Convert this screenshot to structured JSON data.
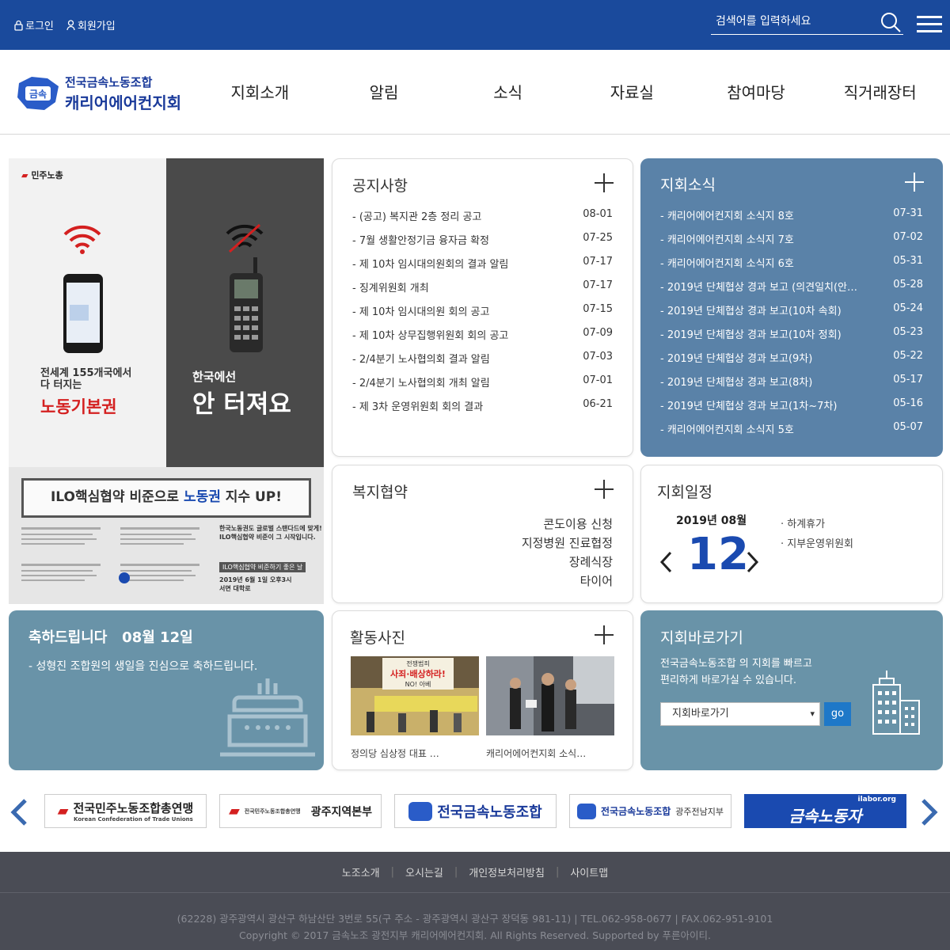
{
  "topbar": {
    "login": "로그인",
    "signup": "회원가입",
    "search_placeholder": "검색어를 입력하세요"
  },
  "logo": {
    "line1": "전국금속노동조합",
    "line2": "캐리어에어컨지회",
    "badge": "금속"
  },
  "nav": [
    "지회소개",
    "알림",
    "소식",
    "자료실",
    "참여마당",
    "직거래장터"
  ],
  "banner": {
    "brand": "민주노총",
    "left_line1": "전세계 155개국에서",
    "left_line2": "다 터지는",
    "left_line3": "노동기본권",
    "right_line1": "한국에선",
    "right_line2": "안 터져요",
    "box_prefix": "ILO핵심협약 비준으로",
    "box_highlight": "노동권",
    "box_suffix": "지수 UP!",
    "foot1": "한국노동권도 글로벌 스탠다드에 맞게!",
    "foot2": "ILO핵심협약 비준이 그 시작입니다.",
    "tag": "ILO핵심협약 비준하기 좋은 날",
    "date": "2019년 6월 1일 오후3시",
    "place": "서면 대학로"
  },
  "notice": {
    "title": "공지사항",
    "items": [
      {
        "title": "- (공고) 복지관 2층 정리 공고",
        "date": "08-01"
      },
      {
        "title": "- 7월 생활안정기금 융자금 확정",
        "date": "07-25"
      },
      {
        "title": "- 제 10차 임시대의원회의 결과 알림",
        "date": "07-17"
      },
      {
        "title": "- 징계위원회 개최",
        "date": "07-17"
      },
      {
        "title": "- 제 10차 임시대의원 회의 공고",
        "date": "07-15"
      },
      {
        "title": "- 제 10차 상무집행위원회 회의 공고",
        "date": "07-09"
      },
      {
        "title": "- 2/4분기 노사협의회 결과 알림",
        "date": "07-03"
      },
      {
        "title": "- 2/4분기 노사협의회 개최 알림",
        "date": "07-01"
      },
      {
        "title": "- 제 3차 운영위원회 회의 결과",
        "date": "06-21"
      }
    ]
  },
  "news": {
    "title": "지회소식",
    "items": [
      {
        "title": "- 캐리어에어컨지회 소식지 8호",
        "date": "07-31"
      },
      {
        "title": "- 캐리어에어컨지회 소식지 7호",
        "date": "07-02"
      },
      {
        "title": "- 캐리어에어컨지회 소식지 6호",
        "date": "05-31"
      },
      {
        "title": "- 2019년 단체협상 경과 보고 (의견일치(안…",
        "date": "05-28"
      },
      {
        "title": "- 2019년 단체협상 경과 보고(10차 속회)",
        "date": "05-24"
      },
      {
        "title": "- 2019년 단체협상 경과 보고(10차 정회)",
        "date": "05-23"
      },
      {
        "title": "- 2019년 단체협상 경과 보고(9차)",
        "date": "05-22"
      },
      {
        "title": "- 2019년 단체협상 경과 보고(8차)",
        "date": "05-17"
      },
      {
        "title": "- 2019년 단체협상 경과 보고(1차~7차)",
        "date": "05-16"
      },
      {
        "title": "- 캐리어에어컨지회 소식지 5호",
        "date": "05-07"
      }
    ]
  },
  "welfare": {
    "title": "복지협약",
    "items": [
      "콘도이용 신청",
      "지정병원 진료협정",
      "장례식장",
      "타이어"
    ]
  },
  "schedule": {
    "title": "지회일정",
    "month": "2019년 08월",
    "day": "12",
    "events": [
      "· 하계휴가",
      "· 지부운영위원회"
    ]
  },
  "birthday": {
    "title": "축하드립니다",
    "date": "08월 12일",
    "message": "- 성형진 조합원의 생일을 진심으로 축하드립니다."
  },
  "photos": {
    "title": "활동사진",
    "items": [
      {
        "caption": "정의당 심상정 대표 …",
        "sign1": "전쟁범죄",
        "sign2": "사죄·배상하라!",
        "sign3": "NO! 아베"
      },
      {
        "caption": "캐리어에어컨지회 소식…"
      }
    ]
  },
  "quicklink": {
    "title": "지회바로가기",
    "desc1": "전국금속노동조합 의 지회를 빠르고",
    "desc2": "편리하게 바로가실 수 있습니다.",
    "select": "지회바로가기",
    "go": "go"
  },
  "partners": [
    {
      "name": "전국민주노동조합총연맹",
      "sub": "Korean Confederation of Trade Unions"
    },
    {
      "name": "광주지역본부",
      "sub": "전국민주노동조합총연맹"
    },
    {
      "name": "전국금속노동조합"
    },
    {
      "name": "전국금속노동조합",
      "sub": "광주전남지부"
    },
    {
      "name": "금속노동자",
      "sub": "ilabor.org"
    }
  ],
  "footer": {
    "links": [
      "노조소개",
      "오시는길",
      "개인정보처리방침",
      "사이트맵"
    ],
    "address": "(62228) 광주광역시 광산구 하남산단 3번로 55(구 주소 - 광주광역시 광산구 장덕동 981-11)  |  TEL.062-958-0677  |  FAX.062-951-9101",
    "copyright": "Copyright © 2017 금속노조 광전지부 캐리어에어컨지회. All Rights Reserved. Supported by 푸른아이티."
  },
  "colors": {
    "topbar": "#1a4a9c",
    "news_card": "#5a82a8",
    "teal_card": "#6993a8",
    "accent_blue": "#1a4ab0",
    "footer": "#4a4c55"
  }
}
